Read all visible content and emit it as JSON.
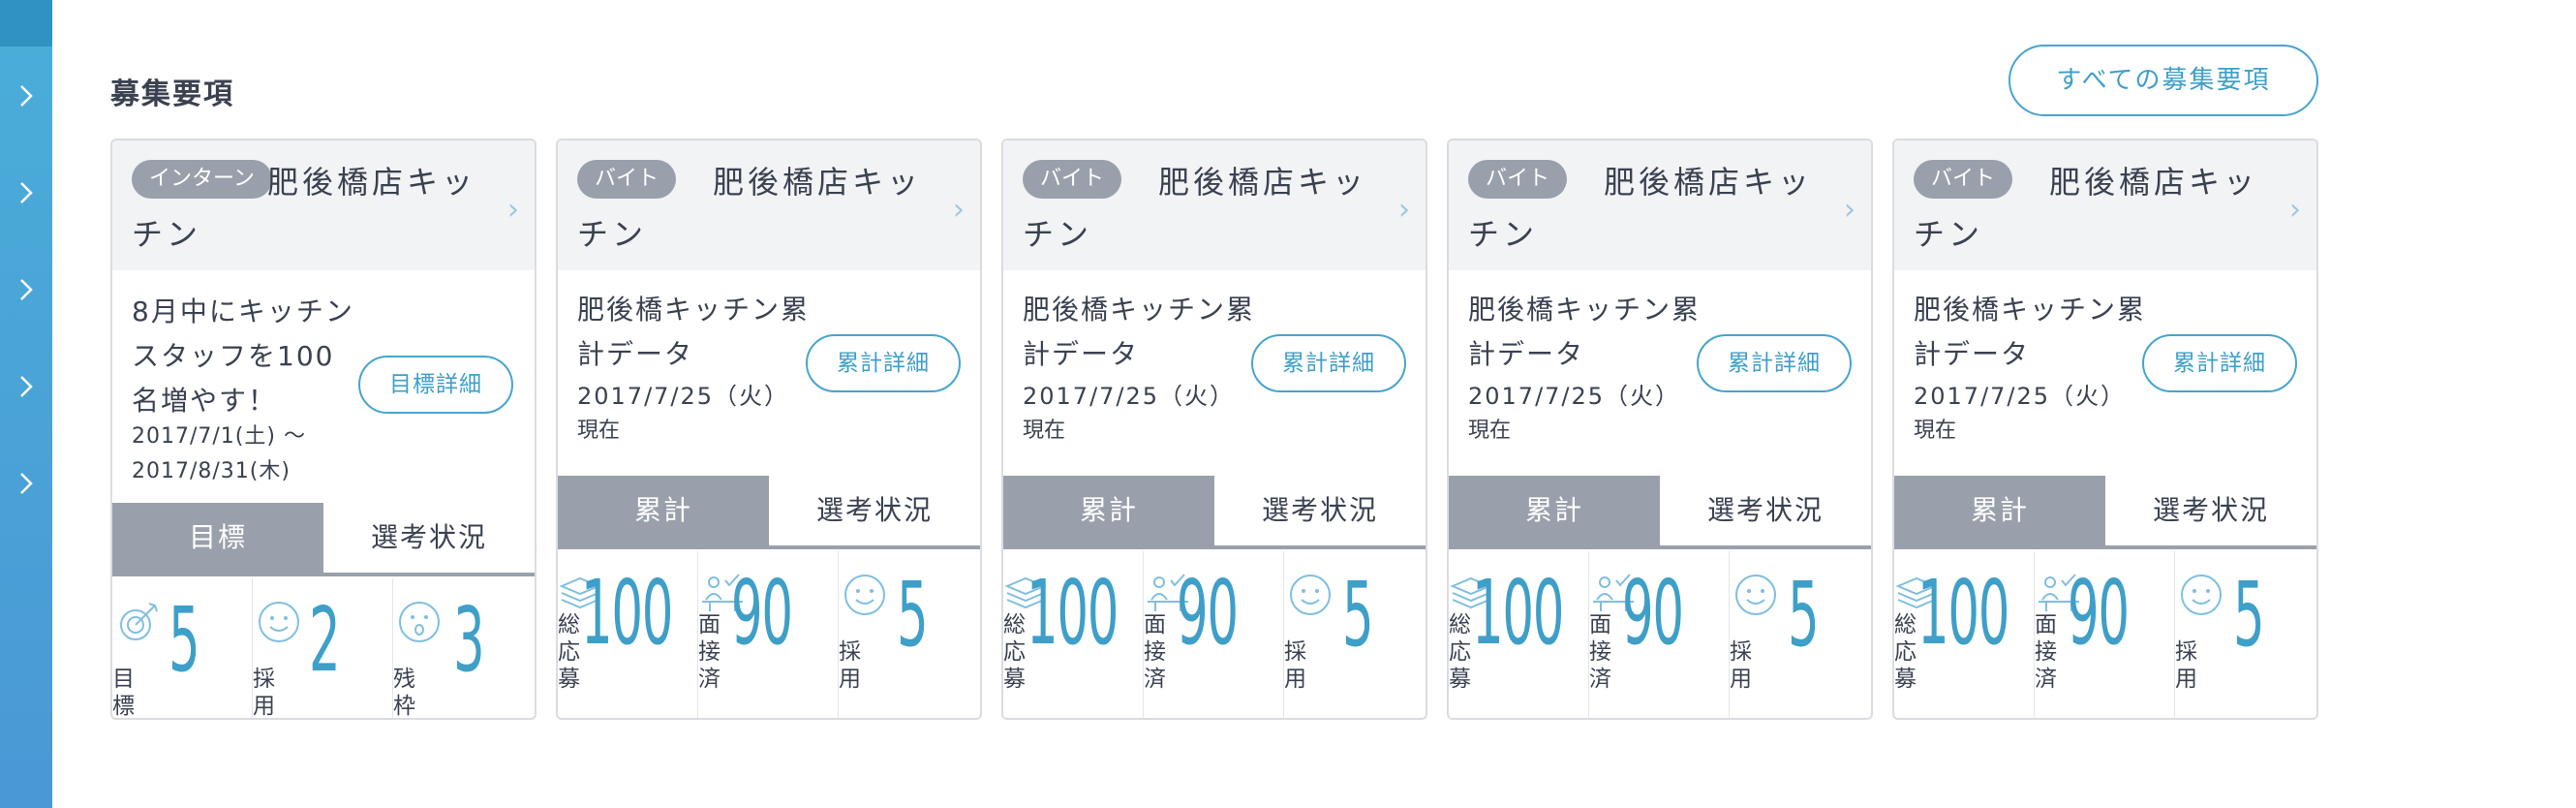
{
  "section_title": "募集要項",
  "all_button": "すべての募集要項",
  "colors": {
    "accent": "#46a4cf",
    "tag": "#9aa0ab",
    "sidebar": "#4aaed8"
  },
  "goal_card": {
    "tag": "インターン",
    "title": "肥後橋店キッチン",
    "goal_text": "8月中にキッチンスタッフを100名増やす！",
    "date_range": "2017/7/1(土) 〜 2017/8/31(木)",
    "detail_button": "目標詳細",
    "tab_active": "目標",
    "tab_inactive": "選考状況",
    "stats": [
      {
        "icon": "target-icon",
        "label": "目標",
        "value": "5"
      },
      {
        "icon": "smile-icon",
        "label": "採用",
        "value": "2"
      },
      {
        "icon": "surprised-icon",
        "label": "残枠",
        "value": "3"
      }
    ]
  },
  "cards": [
    {
      "tag": "バイト",
      "title": "肥後橋店キッチン",
      "subtitle": "肥後橋キッチン累計データ",
      "date": "2017/7/25（火）",
      "now": "現在",
      "detail_button": "累計詳細",
      "tab_active": "累計",
      "tab_inactive": "選考状況",
      "stats": [
        {
          "icon": "stack-icon",
          "label": "総応募",
          "value": "100"
        },
        {
          "icon": "interview-icon",
          "label": "面接済",
          "value": "90"
        },
        {
          "icon": "smile-icon",
          "label": "採用",
          "value": "5"
        }
      ]
    },
    {
      "tag": "バイト",
      "title": "肥後橋店キッチン",
      "subtitle": "肥後橋キッチン累計データ",
      "date": "2017/7/25（火）",
      "now": "現在",
      "detail_button": "累計詳細",
      "tab_active": "累計",
      "tab_inactive": "選考状況",
      "stats": [
        {
          "icon": "stack-icon",
          "label": "総応募",
          "value": "100"
        },
        {
          "icon": "interview-icon",
          "label": "面接済",
          "value": "90"
        },
        {
          "icon": "smile-icon",
          "label": "採用",
          "value": "5"
        }
      ]
    },
    {
      "tag": "バイト",
      "title": "肥後橋店キッチン",
      "subtitle": "肥後橋キッチン累計データ",
      "date": "2017/7/25（火）",
      "now": "現在",
      "detail_button": "累計詳細",
      "tab_active": "累計",
      "tab_inactive": "選考状況",
      "stats": [
        {
          "icon": "stack-icon",
          "label": "総応募",
          "value": "100"
        },
        {
          "icon": "interview-icon",
          "label": "面接済",
          "value": "90"
        },
        {
          "icon": "smile-icon",
          "label": "採用",
          "value": "5"
        }
      ]
    },
    {
      "tag": "バイト",
      "title": "肥後橋店キッチン",
      "subtitle": "肥後橋キッチン累計データ",
      "date": "2017/7/25（火）",
      "now": "現在",
      "detail_button": "累計詳細",
      "tab_active": "累計",
      "tab_inactive": "選考状況",
      "stats": [
        {
          "icon": "stack-icon",
          "label": "総応募",
          "value": "100"
        },
        {
          "icon": "interview-icon",
          "label": "面接済",
          "value": "90"
        },
        {
          "icon": "smile-icon",
          "label": "採用",
          "value": "5"
        }
      ]
    }
  ]
}
